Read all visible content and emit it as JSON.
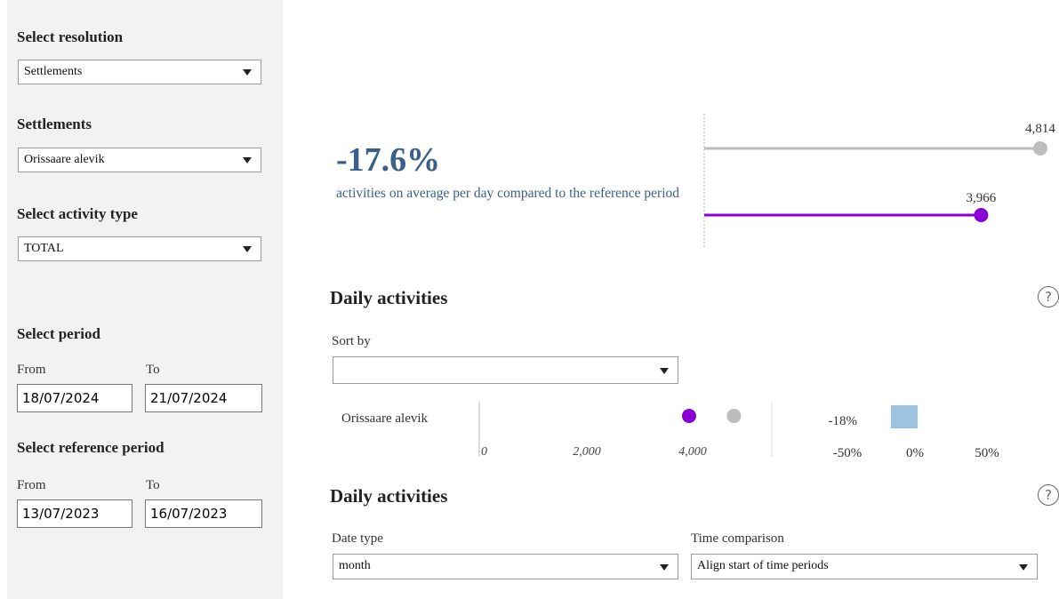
{
  "sidebar": {
    "resolution_label": "Select resolution",
    "resolution_value": "Settlements",
    "settlements_label": "Settlements",
    "settlements_value": "Orissaare alevik",
    "activity_label": "Select activity type",
    "activity_value": "TOTAL",
    "period_label": "Select period",
    "from_label": "From",
    "to_label": "To",
    "period_from": "18/07/2024",
    "period_to": "21/07/2024",
    "ref_label": "Select reference period",
    "ref_from_label": "From",
    "ref_to_label": "To",
    "ref_from": "13/07/2023",
    "ref_to": "16/07/2023"
  },
  "summary": {
    "percent": "-17.6%",
    "text": "activities on average per day compared to the reference period",
    "reference_value_label": "4,814",
    "current_value_label": "3,966"
  },
  "daily1": {
    "title": "Daily activities",
    "help": "?",
    "sort_label": "Sort by",
    "sort_value": "",
    "row_label": "Orissaare alevik",
    "pct_label": "-18%",
    "x_ticks": [
      "0",
      "2,000",
      "4,000"
    ],
    "pct_ticks": [
      "-50%",
      "0%",
      "50%"
    ]
  },
  "daily2": {
    "title": "Daily activities",
    "help": "?",
    "date_type_label": "Date type",
    "date_type_value": "month",
    "time_comp_label": "Time comparison",
    "time_comp_value": "Align start of time periods"
  },
  "colors": {
    "accent_blue": "#3a5f8a",
    "current_purple": "#8a00d4",
    "reference_gray": "#bdbdbd",
    "pct_bar_blue": "#9ec3e0"
  },
  "chart_data": [
    {
      "type": "scatter",
      "series": [
        {
          "name": "",
          "values": [
            4814
          ]
        },
        {
          "name": "",
          "values": [
            3966
          ]
        }
      ]
    },
    {
      "type": "scatter",
      "categories": [
        "Orissaare alevik"
      ],
      "series": [
        {
          "name": "",
          "values": [
            3966
          ]
        },
        {
          "name": "",
          "values": [
            4814
          ]
        }
      ],
      "x_ticks": [
        "0",
        "2,000",
        "4,000"
      ],
      "xlim": [
        0,
        5500
      ]
    },
    {
      "type": "bar",
      "categories": [
        "Orissaare alevik"
      ],
      "values": [
        -18
      ],
      "x_ticks": [
        "-50%",
        "0%",
        "50%"
      ],
      "xlim": [
        -50,
        50
      ]
    }
  ]
}
